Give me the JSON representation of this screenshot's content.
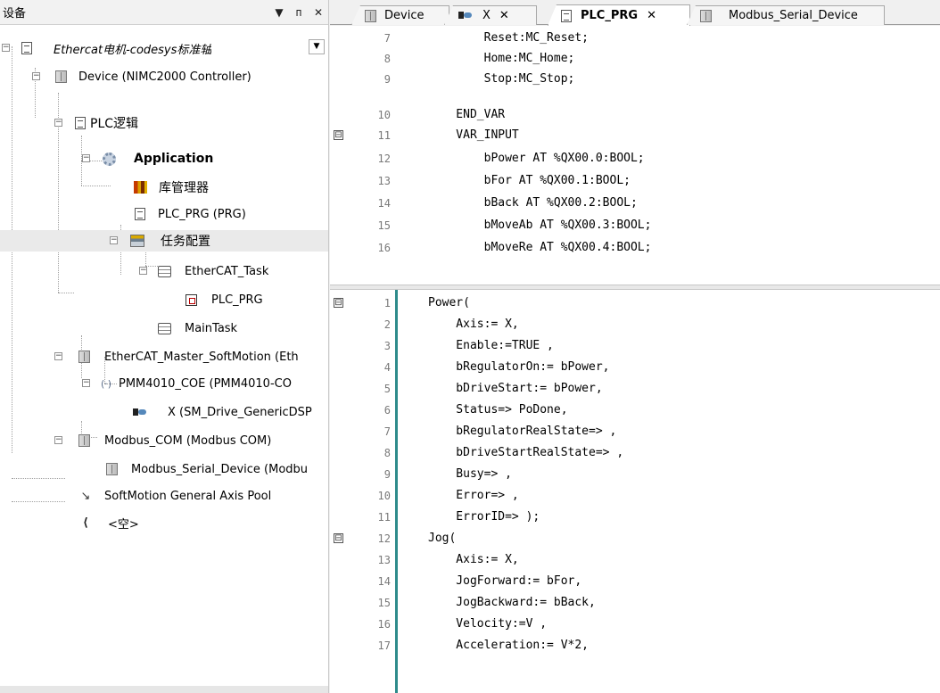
{
  "panel": {
    "title": "设备",
    "btn_dropdown": "▼",
    "btn_pin": "ᴨ",
    "btn_close": "✕"
  },
  "tree": [
    {
      "label": "Ethercat电机-codesys标准轴",
      "icon": "project-doc-icon"
    },
    {
      "label": "Device (NIMC2000 Controller)",
      "icon": "device-icon"
    },
    {
      "label": "PLC逻辑",
      "icon": "plc-logic-icon"
    },
    {
      "label": "Application",
      "icon": "application-gear-icon"
    },
    {
      "label": "库管理器",
      "icon": "library-books-icon"
    },
    {
      "label": "PLC_PRG (PRG)",
      "icon": "program-doc-icon"
    },
    {
      "label": "任务配置",
      "icon": "task-config-icon"
    },
    {
      "label": "EtherCAT_Task",
      "icon": "task-stack-icon"
    },
    {
      "label": "PLC_PRG",
      "icon": "program-call-icon"
    },
    {
      "label": "MainTask",
      "icon": "task-stack-icon"
    },
    {
      "label": "EtherCAT_Master_SoftMotion (Eth",
      "icon": "device-icon"
    },
    {
      "label": "PMM4010_COE (PMM4010-CO",
      "icon": "network-device-icon"
    },
    {
      "label": "X (SM_Drive_GenericDSP",
      "icon": "axis-drive-icon"
    },
    {
      "label": "Modbus_COM (Modbus COM)",
      "icon": "device-icon"
    },
    {
      "label": "Modbus_Serial_Device (Modbu",
      "icon": "device-icon"
    },
    {
      "label": "SoftMotion General Axis Pool",
      "icon": "axis-pool-icon"
    },
    {
      "label": "<空>",
      "icon": "empty-slot-icon"
    }
  ],
  "tabs": [
    {
      "label": "Device",
      "icon": "device-icon",
      "active": false
    },
    {
      "label": "X",
      "icon": "axis-drive-icon",
      "active": false,
      "close": "✕"
    },
    {
      "label": "PLC_PRG",
      "icon": "program-doc-icon",
      "active": true,
      "close": "✕"
    },
    {
      "label": "Modbus_Serial_Device",
      "icon": "device-icon",
      "active": false
    }
  ],
  "decl": [
    {
      "n": "7",
      "code": "        Reset:MC_Reset;"
    },
    {
      "n": "8",
      "code": "        Home:MC_Home;"
    },
    {
      "n": "9",
      "code": "        Stop:MC_Stop;"
    },
    {
      "n": "10",
      "code": "    END_VAR"
    },
    {
      "n": "11",
      "code": "    VAR_INPUT",
      "fold": "⊟"
    },
    {
      "n": "12",
      "code": "        bPower AT %QX00.0:BOOL;"
    },
    {
      "n": "13",
      "code": "        bFor AT %QX00.1:BOOL;"
    },
    {
      "n": "14",
      "code": "        bBack AT %QX00.2:BOOL;"
    },
    {
      "n": "15",
      "code": "        bMoveAb AT %QX00.3:BOOL;"
    },
    {
      "n": "16",
      "code": "        bMoveRe AT %QX00.4:BOOL;"
    }
  ],
  "body": [
    {
      "n": "1",
      "code": "Power(",
      "fold": "⊟"
    },
    {
      "n": "2",
      "code": "    Axis:= X,"
    },
    {
      "n": "3",
      "code": "    Enable:=TRUE ,"
    },
    {
      "n": "4",
      "code": "    bRegulatorOn:= bPower,"
    },
    {
      "n": "5",
      "code": "    bDriveStart:= bPower,"
    },
    {
      "n": "6",
      "code": "    Status=> PoDone,"
    },
    {
      "n": "7",
      "code": "    bRegulatorRealState=> ,"
    },
    {
      "n": "8",
      "code": "    bDriveStartRealState=> ,"
    },
    {
      "n": "9",
      "code": "    Busy=> ,"
    },
    {
      "n": "10",
      "code": "    Error=> ,"
    },
    {
      "n": "11",
      "code": "    ErrorID=> );"
    },
    {
      "n": "12",
      "code": "Jog(",
      "fold": "⊟"
    },
    {
      "n": "13",
      "code": "    Axis:= X,"
    },
    {
      "n": "14",
      "code": "    JogForward:= bFor,"
    },
    {
      "n": "15",
      "code": "    JogBackward:= bBack,"
    },
    {
      "n": "16",
      "code": "    Velocity:=V ,"
    },
    {
      "n": "17",
      "code": "    Acceleration:= V*2,"
    }
  ],
  "colors": {
    "keyword": "#0000c8",
    "literal": "#7c3a8f",
    "gutter_bar": "#2e8b8b"
  }
}
